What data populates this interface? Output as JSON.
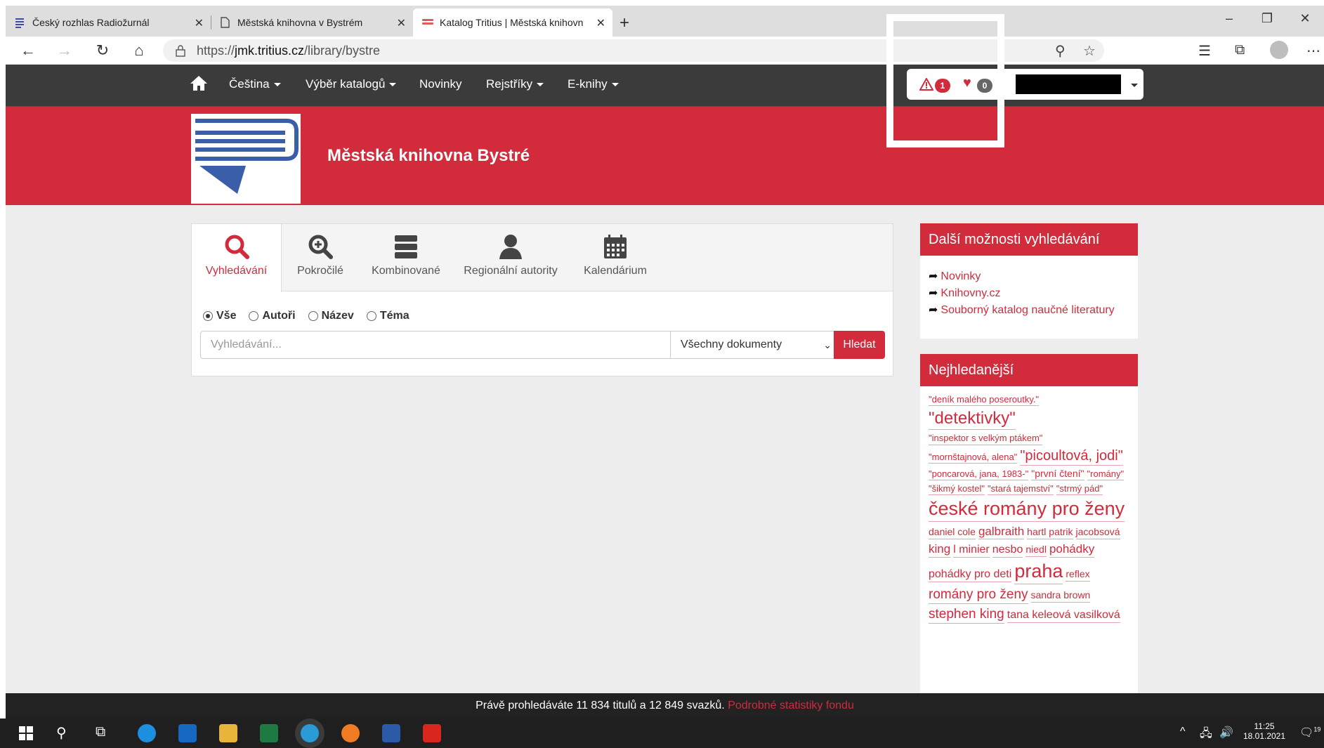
{
  "browser": {
    "tabs": [
      {
        "title": "Český rozhlas Radiožurnál",
        "active": false
      },
      {
        "title": "Městská knihovna v Bystrém",
        "active": false
      },
      {
        "title": "Katalog Tritius | Městská knihovn",
        "active": true
      }
    ],
    "url_prefix": "https://",
    "url_domain": "jmk.tritius.cz",
    "url_path": "/library/bystre"
  },
  "nav": {
    "items": [
      "Čeština",
      "Výběr katalogů",
      "Novinky",
      "Rejstříky",
      "E-knihy"
    ],
    "warn_count": "1",
    "fav_count": "0"
  },
  "banner": {
    "title": "Městská knihovna Bystré"
  },
  "search": {
    "tabs": [
      "Vyhledávání",
      "Pokročilé",
      "Kombinované",
      "Regionální autority",
      "Kalendárium"
    ],
    "radios": [
      "Vše",
      "Autoři",
      "Název",
      "Téma"
    ],
    "placeholder": "Vyhledávání...",
    "doc_filter": "Všechny dokumenty",
    "button": "Hledat"
  },
  "sidebar": {
    "more_title": "Další možnosti vyhledávání",
    "more_links": [
      "Novinky",
      "Knihovny.cz",
      "Souborný katalog naučné literatury"
    ],
    "popular_title": "Nejhledanější",
    "tags": [
      {
        "text": "\"deník malého poseroutky.\"",
        "size": 13
      },
      {
        "text": "\"detektivky\"",
        "size": 24
      },
      {
        "text": "\"inspektor s velkým ptákem\"",
        "size": 13
      },
      {
        "text": "\"mornštajnová, alena\"",
        "size": 13
      },
      {
        "text": "\"picoultová, jodi\"",
        "size": 20
      },
      {
        "text": "\"poncarová, jana, 1983-\"",
        "size": 13
      },
      {
        "text": "\"první čtení\"",
        "size": 14
      },
      {
        "text": "\"romány\"",
        "size": 13
      },
      {
        "text": "\"šikmý kostel\"",
        "size": 13
      },
      {
        "text": "\"stará tajemství\"",
        "size": 13
      },
      {
        "text": "\"strmý pád\"",
        "size": 13
      },
      {
        "text": "české romány pro ženy",
        "size": 27
      },
      {
        "text": "daniel cole",
        "size": 14
      },
      {
        "text": "galbraith",
        "size": 17
      },
      {
        "text": "hartl patrik",
        "size": 14
      },
      {
        "text": "jacobsová",
        "size": 14
      },
      {
        "text": "king",
        "size": 17
      },
      {
        "text": "l minier",
        "size": 16
      },
      {
        "text": "nesbo",
        "size": 16
      },
      {
        "text": "niedl",
        "size": 14
      },
      {
        "text": "pohádky",
        "size": 17
      },
      {
        "text": "pohádky pro deti",
        "size": 16
      },
      {
        "text": "praha",
        "size": 27
      },
      {
        "text": "reflex",
        "size": 14
      },
      {
        "text": "romány pro ženy",
        "size": 19
      },
      {
        "text": "sandra brown",
        "size": 14
      },
      {
        "text": "stephen king",
        "size": 19
      },
      {
        "text": "tana keleová vasilková",
        "size": 16
      }
    ]
  },
  "footer": {
    "text": "Právě prohledáváte 11 834 titulů a 12 849 svazků.",
    "link": "Podrobné statistiky fondu"
  },
  "taskbar": {
    "time": "11:25",
    "date": "18.01.2021",
    "notifications": "19"
  },
  "colors": {
    "brand": "#d12b3c",
    "nav": "#3b3b3b"
  }
}
